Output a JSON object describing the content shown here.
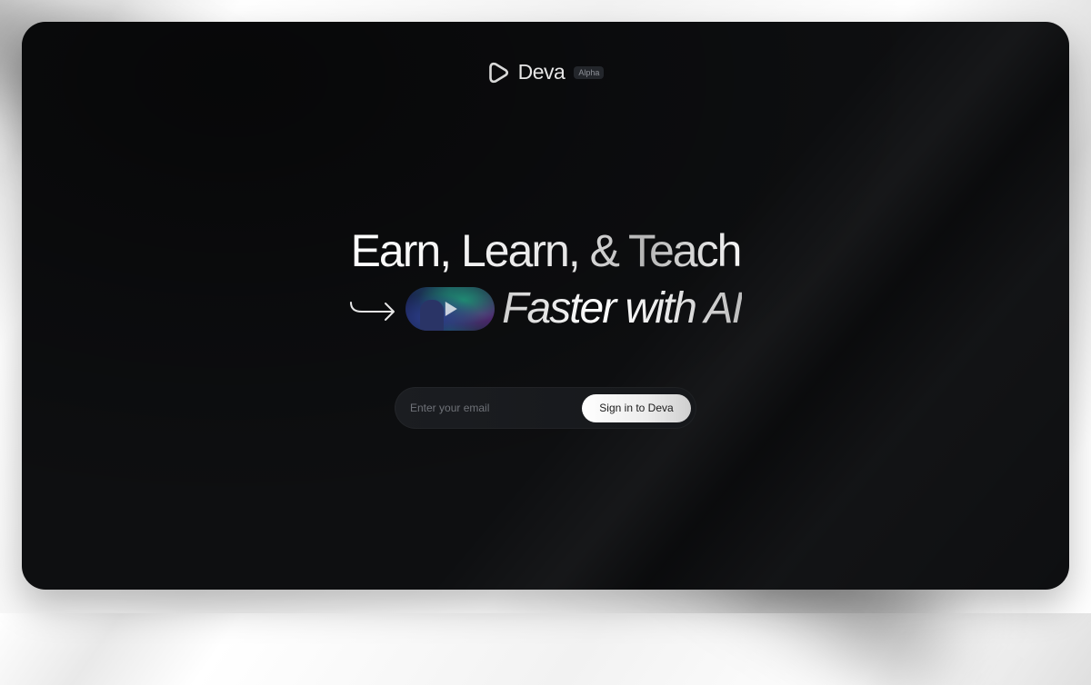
{
  "brand": {
    "name": "Deva",
    "badge": "Alpha",
    "logo_icon": "deva-logo-icon"
  },
  "hero": {
    "line1": "Earn, Learn, & Teach",
    "line2": "Faster with AI",
    "arrow_icon": "curved-arrow-right-icon",
    "video_icon": "play-icon"
  },
  "signin": {
    "email_placeholder": "Enter your email",
    "button_label": "Sign in to Deva"
  },
  "colors": {
    "panel_background": "#0e0f11",
    "button_background": "#ffffff",
    "text_primary": "#f2f2f2"
  }
}
